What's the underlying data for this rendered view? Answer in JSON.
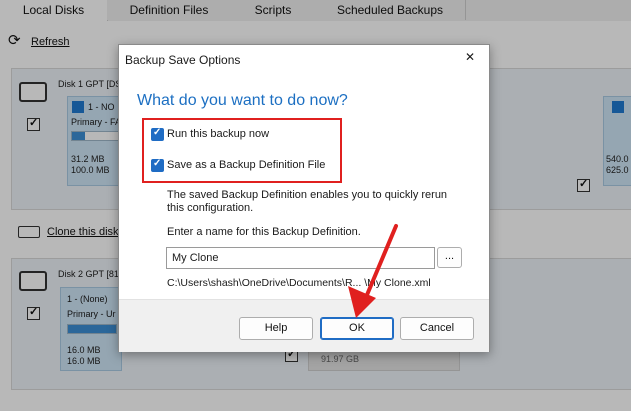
{
  "tabs": [
    "Local Disks",
    "Definition Files",
    "Scripts",
    "Scheduled Backups"
  ],
  "toolbar": {
    "refresh": "Refresh",
    "clone": "Clone this disk"
  },
  "disk1": {
    "title": "Disk 1 GPT [DS",
    "partition": {
      "name": "1 - NO",
      "type": "Primary - FA",
      "used": "31.2 MB",
      "total": "100.0 MB",
      "fill": 0.25
    },
    "right": {
      "used": "540.0",
      "total": "625.0"
    }
  },
  "disk2": {
    "title": "Disk 2 GPT [81",
    "partition": {
      "name": "1 - (None)",
      "type": "Primary - Ur",
      "used": "16.0 MB",
      "total": "16.0 MB",
      "fill": 1.0
    },
    "free": "91.97 GB"
  },
  "dialog": {
    "title": "Backup Save Options",
    "close": "✕",
    "heading": "What do you want to do now?",
    "option_run": "Run this backup now",
    "option_save": "Save as a Backup Definition File",
    "description": "The saved Backup Definition enables you to quickly rerun this configuration.",
    "prompt": "Enter a name for this Backup Definition.",
    "name_value": "My Clone",
    "browse": "...",
    "path": "C:\\Users\\shash\\OneDrive\\Documents\\R... \\My Clone.xml",
    "help": "Help",
    "ok": "OK",
    "cancel": "Cancel"
  },
  "colors": {
    "accent": "#1f6cc4",
    "highlight": "#e0201f"
  }
}
